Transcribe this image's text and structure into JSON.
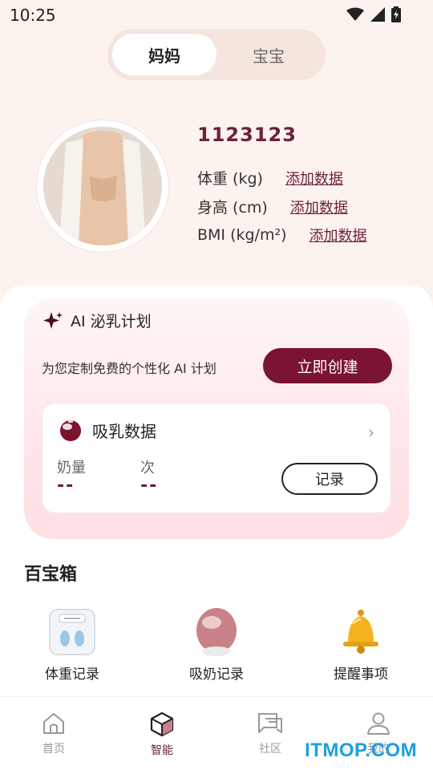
{
  "status_bar": {
    "time": "10:25"
  },
  "segment": {
    "active": "妈妈",
    "inactive": "宝宝"
  },
  "profile": {
    "id": "1123123",
    "metrics": [
      {
        "label": "体重 (kg)",
        "action": "添加数据"
      },
      {
        "label": "身高 (cm)",
        "action": "添加数据"
      },
      {
        "label": "BMI (kg/m²)",
        "action": "添加数据"
      }
    ]
  },
  "ai_plan": {
    "title": "AI 泌乳计划",
    "description": "为您定制免费的个性化 AI 计划",
    "button": "立即创建"
  },
  "pump_data": {
    "title": "吸乳数据",
    "stats": [
      {
        "label": "奶量",
        "value": "--"
      },
      {
        "label": "次",
        "value": "--"
      }
    ],
    "record_button": "记录"
  },
  "toolbox": {
    "title": "百宝箱",
    "items": [
      {
        "label": "体重记录",
        "icon": "scale-icon"
      },
      {
        "label": "吸奶记录",
        "icon": "breast-pump-icon"
      },
      {
        "label": "提醒事项",
        "icon": "bell-icon"
      }
    ]
  },
  "tabbar": {
    "items": [
      {
        "label": "首页",
        "icon": "home-icon",
        "active": false
      },
      {
        "label": "智能",
        "icon": "cube-icon",
        "active": true
      },
      {
        "label": "社区",
        "icon": "chat-icon",
        "active": false
      },
      {
        "label": "我的",
        "icon": "user-icon",
        "active": false
      }
    ]
  },
  "colors": {
    "brand": "#7a1431",
    "accent_text": "#6b2138",
    "background": "#fdf3ee"
  },
  "watermark": "ITMOP.COM"
}
